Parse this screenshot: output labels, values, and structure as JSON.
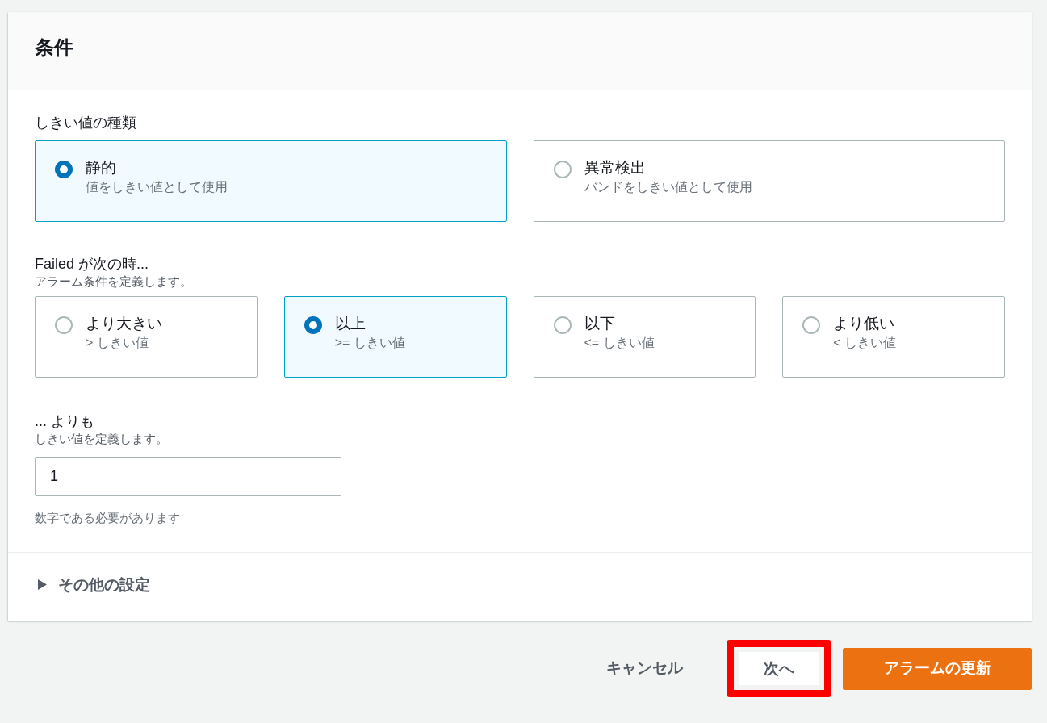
{
  "panel": {
    "title": "条件"
  },
  "threshold_type": {
    "label": "しきい値の種類",
    "options": [
      {
        "label": "静的",
        "description": "値をしきい値として使用",
        "selected": true
      },
      {
        "label": "異常検出",
        "description": "バンドをしきい値として使用",
        "selected": false
      }
    ]
  },
  "condition": {
    "label": "Failed が次の時...",
    "description": "アラーム条件を定義します。",
    "options": [
      {
        "label": "より大きい",
        "description": "> しきい値",
        "selected": false
      },
      {
        "label": "以上",
        "description": ">= しきい値",
        "selected": true
      },
      {
        "label": "以下",
        "description": "<= しきい値",
        "selected": false
      },
      {
        "label": "より低い",
        "description": "< しきい値",
        "selected": false
      }
    ]
  },
  "threshold": {
    "label": "... よりも",
    "description": "しきい値を定義します。",
    "value": "1",
    "hint": "数字である必要があります"
  },
  "additional_settings": {
    "label": "その他の設定",
    "expanded": false
  },
  "buttons": [
    {
      "label": "キャンセル",
      "kind": "link",
      "highlighted": false
    },
    {
      "label": "次へ",
      "kind": "normal",
      "highlighted": true
    },
    {
      "label": "アラームの更新",
      "kind": "primary",
      "highlighted": false
    }
  ]
}
